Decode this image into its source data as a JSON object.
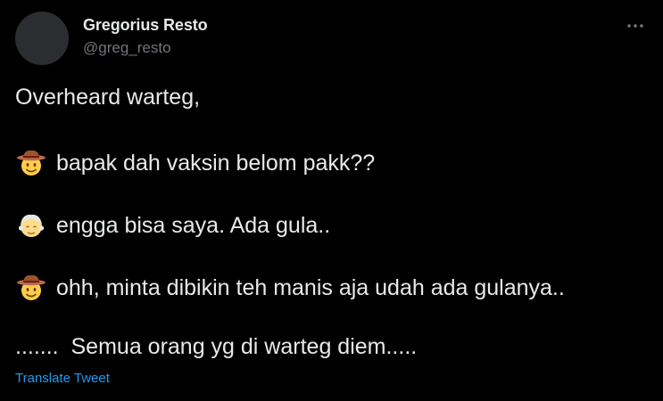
{
  "author": {
    "name": "Gregorius Resto",
    "handle": "@greg_resto"
  },
  "tweet": {
    "line1": "Overheard warteg,",
    "line2": "bapak dah vaksin belom pakk??",
    "line3": "engga bisa saya. Ada gula..",
    "line4": "ohh, minta dibikin teh manis aja udah ada gulanya..",
    "line5": ".......  Semua orang yg di warteg diem.....",
    "emojis": [
      "cowboy-hat-face",
      "older-person",
      "cowboy-hat-face"
    ]
  },
  "actions": {
    "translate_label": "Translate Tweet",
    "more_icon": "ellipsis-icon"
  },
  "colors": {
    "background": "#000000",
    "text": "#e7e9ea",
    "handle": "#71767b",
    "link": "#1d9bf0"
  }
}
